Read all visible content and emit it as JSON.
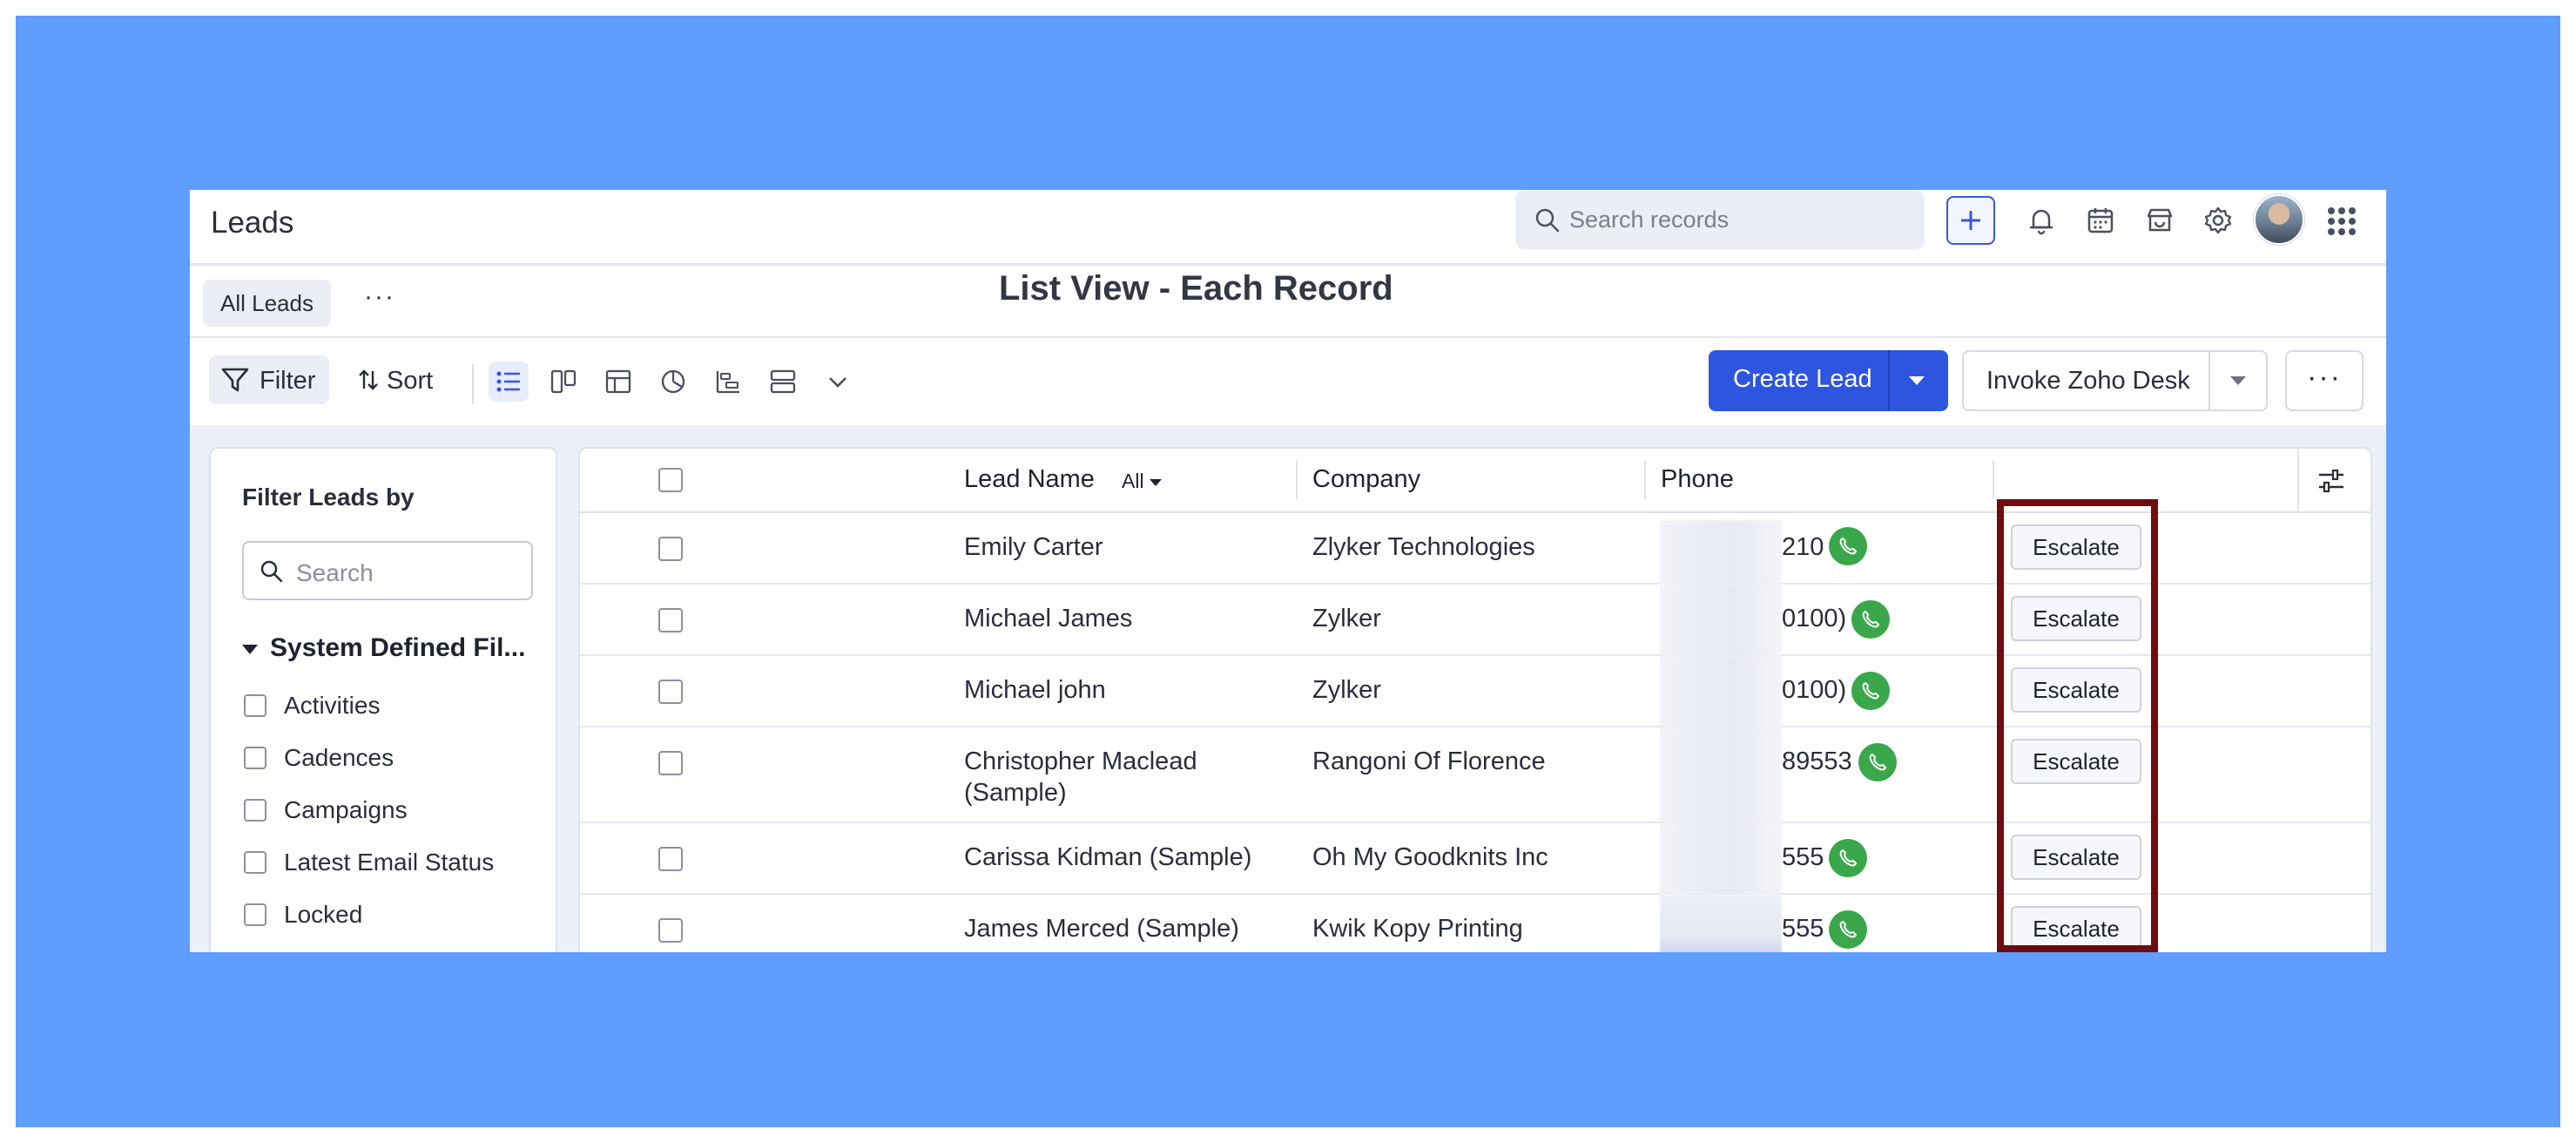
{
  "app": {
    "title": "Leads"
  },
  "search": {
    "placeholder": "Search records"
  },
  "view_tabs": {
    "active": "All Leads",
    "more": "···"
  },
  "annotation": {
    "title": "List View - Each Record"
  },
  "toolbar": {
    "filter_label": "Filter",
    "sort_label": "Sort",
    "create_label": "Create Lead",
    "invoke_label": "Invoke Zoho Desk",
    "more_label": "···"
  },
  "filter_panel": {
    "title": "Filter Leads by",
    "search_placeholder": "Search",
    "section": "System Defined Fil...",
    "items": [
      "Activities",
      "Cadences",
      "Campaigns",
      "Latest Email Status",
      "Locked"
    ]
  },
  "table": {
    "columns": {
      "lead_name": "Lead Name",
      "filter_all": "All",
      "company": "Company",
      "phone": "Phone"
    },
    "action_label": "Escalate",
    "rows": [
      {
        "name": "Emily Carter",
        "company": "Zlyker Technologies",
        "phone_suffix": "210"
      },
      {
        "name": "Michael James",
        "company": "Zylker",
        "phone_suffix": "0100)"
      },
      {
        "name": "Michael john",
        "company": "Zylker",
        "phone_suffix": "0100)"
      },
      {
        "name": "Christopher Maclead (Sample)",
        "company": "Rangoni Of Florence",
        "phone_suffix": "89553"
      },
      {
        "name": "Carissa Kidman (Sample)",
        "company": "Oh My Goodknits Inc",
        "phone_suffix": "555"
      },
      {
        "name": "James Merced (Sample)",
        "company": "Kwik Kopy Printing",
        "phone_suffix": "555"
      }
    ]
  },
  "colors": {
    "accent": "#2e55e0",
    "backdrop": "#5f9dff",
    "highlight": "#6d0d0d",
    "call": "#3aa84a"
  }
}
